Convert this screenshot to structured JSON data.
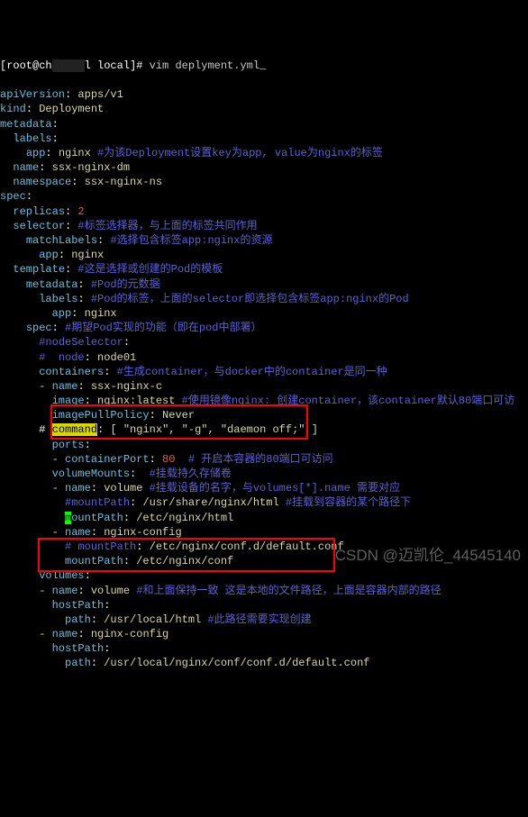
{
  "prompt": {
    "user": "[root@ch",
    "host": "l local]# ",
    "cmd": "vim deplyment.yml"
  },
  "k": {
    "apiVersion": "apiVersion",
    "kind": "kind",
    "metadata": "metadata",
    "labels": "labels",
    "app": "app",
    "name": "name",
    "namespace": "namespace",
    "spec": "spec",
    "replicas": "replicas",
    "selector": "selector",
    "matchLabels": "matchLabels",
    "template": "template",
    "nodeSelector": "#nodeSelector",
    "node": "#  node",
    "containers": "containers",
    "image": "image",
    "imagePullPolicy": "imagePullPolicy",
    "command": "command",
    "ports": "ports",
    "containerPort": "containerPort",
    "volumeMounts": "volumeMounts",
    "mountPath1": "#mountPath",
    "mountPath2": "ountPath",
    "mountPathC": "# mountPath",
    "mountPath": "mountPath",
    "volumes": "volumes",
    "hostPath": "hostPath",
    "path": "path"
  },
  "v": {
    "apiVersion": "apps/v1",
    "kind": "Deployment",
    "appnginx": "nginx ",
    "labelComment": "#为该Deployment设置key为app, value为nginx的标签",
    "nameDm": "ssx-nginx-dm",
    "ns": "ssx-nginx-ns",
    "replicas": "2",
    "selComment": "#标签选择器，与上面的标签共同作用",
    "matchComment": "#选择包含标签app:nginx的资源",
    "nginx": "nginx",
    "tmplComment": "#这是选择或创建的Pod的模板",
    "metaComment": "#Pod的元数据",
    "lblComment": "#Pod的标签，上面的selector即选择包含标签app:nginx的Pod",
    "specComment": "#期望Pod实现的功能（即在pod中部署）",
    "nodeVal": "node01",
    "contComment": "#生成container，与docker中的container是同一种",
    "contName": "ssx-nginx-c",
    "imageVal": "nginx:latest ",
    "imageComment": "#使用镜像nginx: 创建container，该container默认80端口可访",
    "never": "Never",
    "cmdArr": "[ \"nginx\", \"-g\", \"daemon off;\" ]",
    "port80": "80",
    "portComment": "  # 开启本容器的80端口可访问",
    "vmComment": "#挂载持久存储卷",
    "volName": "volume ",
    "volNameComment": "#挂载设备的名字，与volumes[*].name 需要对应",
    "mp1": "/usr/share/nginx/html ",
    "mp1Comment": "#挂载到容器的某个路径下",
    "mp2": "/etc/nginx/html",
    "confName": "nginx-config",
    "mpC": "/etc/nginx/conf.d/default.conf",
    "mpC2": "/etc/nginx/conf",
    "volComment": "#和上面保持一致 这是本地的文件路径，上面是容器内部的路径",
    "pathHtml": "/usr/local/html ",
    "pathComment": "#此路径需要实现创建",
    "confName2": "nginx-config",
    "pathConf": "/usr/local/nginx/conf/conf.d/default.conf"
  },
  "watermark": "CSDN @迈凯伦_44545140"
}
